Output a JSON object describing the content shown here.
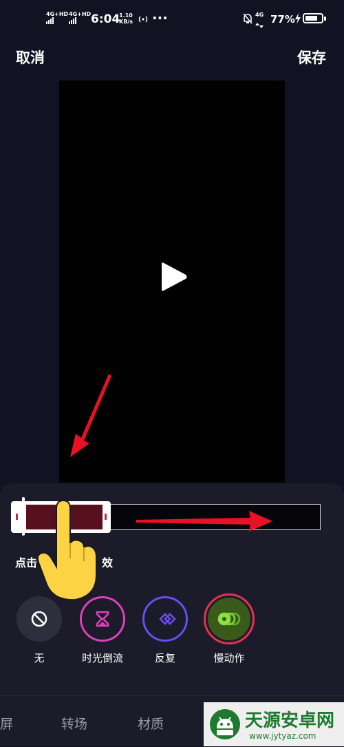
{
  "status_bar": {
    "net1": "4G+HD",
    "net2": "4G+HD",
    "time": "6:04",
    "speed_value": "1.10",
    "speed_unit": "KB/s",
    "dots": "···",
    "net3": "4G",
    "battery_pct": "77%",
    "battery_level": 0.77
  },
  "header": {
    "cancel_label": "取消",
    "save_label": "保存"
  },
  "editor": {
    "hint_visible_left": "点击",
    "hint_visible_right": "效"
  },
  "effects": [
    {
      "label": "无",
      "icon": "no-effect-icon",
      "ring": "#2e2e3c"
    },
    {
      "label": "时光倒流",
      "icon": "hourglass-icon",
      "ring": "#e041b9"
    },
    {
      "label": "反复",
      "icon": "repeat-diamond-icon",
      "ring": "#6b4cf0"
    },
    {
      "label": "慢动作",
      "icon": "slow-motion-icon",
      "ring": "#e9304f",
      "selected": true
    }
  ],
  "tabs": [
    {
      "label": "屏"
    },
    {
      "label": "转场"
    },
    {
      "label": "材质"
    }
  ],
  "watermark": {
    "name": "天源安卓网",
    "url": "www.jytyaz.com"
  },
  "colors": {
    "background": "#121222",
    "panel": "#1b1b2a",
    "annotation_red": "#e81224",
    "hand_yellow": "#fbd344"
  }
}
